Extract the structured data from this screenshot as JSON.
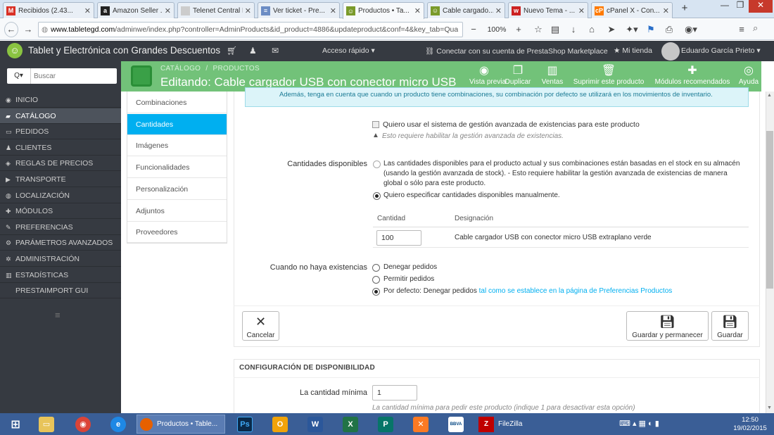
{
  "browser": {
    "tabs": [
      {
        "title": "Recibidos (2.43...",
        "icon": "gmail-icon",
        "color": "#d93025",
        "glyph": "M"
      },
      {
        "title": "Amazon Seller ...",
        "icon": "amazon-icon",
        "color": "#222222",
        "glyph": "a"
      },
      {
        "title": "Telenet Central Lo...",
        "icon": "page-icon",
        "color": "#cccccc",
        "glyph": ""
      },
      {
        "title": "Ver ticket - Pre...",
        "icon": "ticket-icon",
        "color": "#6b8cc4",
        "glyph": "≡"
      },
      {
        "title": "Productos • Ta...",
        "icon": "prestashop-icon",
        "color": "#7a9a2a",
        "glyph": "☺",
        "active": true
      },
      {
        "title": "Cable cargado...",
        "icon": "prestashop-icon",
        "color": "#7a9a2a",
        "glyph": "☺"
      },
      {
        "title": "Nuevo Tema - ...",
        "icon": "forum-icon",
        "color": "#cc2222",
        "glyph": "w"
      },
      {
        "title": "cPanel X - Con...",
        "icon": "cpanel-icon",
        "color": "#ff7a00",
        "glyph": "cP"
      }
    ],
    "new_tab": "+",
    "url_host": "www.tabletegd.com",
    "url_rest": "/adminwe/index.php?controller=AdminProducts&id_product=4886&updateproduct&conf=4&key_tab=Qua",
    "zoom": "100%"
  },
  "header": {
    "shop_name": "Tablet y Electrónica con Grandes Descuentos",
    "quick_access": "Acceso rápido",
    "connect": "Conectar con su cuenta de PrestaShop Marketplace",
    "my_shop": "Mi tienda",
    "user": "Eduardo García Prieto"
  },
  "sidebar": {
    "search_placeholder": "Buscar",
    "search_selector": "Q▾",
    "items": [
      {
        "label": "INICIO",
        "icon": "dashboard-icon",
        "glyph": "◉"
      },
      {
        "label": "CATÁLOGO",
        "icon": "catalog-icon",
        "glyph": "▰",
        "active": true
      },
      {
        "label": "PEDIDOS",
        "icon": "orders-icon",
        "glyph": "▭"
      },
      {
        "label": "CLIENTES",
        "icon": "customers-icon",
        "glyph": "♟"
      },
      {
        "label": "REGLAS DE PRECIOS",
        "icon": "price-rules-icon",
        "glyph": "◈"
      },
      {
        "label": "TRANSPORTE",
        "icon": "truck-icon",
        "glyph": "▶"
      },
      {
        "label": "LOCALIZACIÓN",
        "icon": "globe-icon",
        "glyph": "◍"
      },
      {
        "label": "MÓDULOS",
        "icon": "modules-icon",
        "glyph": "✚"
      },
      {
        "label": "PREFERENCIAS",
        "icon": "wrench-icon",
        "glyph": "✎"
      },
      {
        "label": "PARÁMETROS AVANZADOS",
        "icon": "cogs-icon",
        "glyph": "⚙"
      },
      {
        "label": "ADMINISTRACIÓN",
        "icon": "gear-icon",
        "glyph": "✲"
      },
      {
        "label": "ESTADÍSTICAS",
        "icon": "stats-icon",
        "glyph": "▥"
      },
      {
        "label": "PRESTAIMPORT GUI",
        "icon": "",
        "glyph": ""
      }
    ]
  },
  "toolbar": {
    "breadcrumb_catalog": "CATÁLOGO",
    "breadcrumb_sep": "/",
    "breadcrumb_products": "PRODUCTOS",
    "title": "Editando: Cable cargador USB con conector micro USB ext",
    "buttons": [
      {
        "label": "Vista previa",
        "icon": "eye-icon",
        "glyph": "◉"
      },
      {
        "label": "Duplicar",
        "icon": "copy-icon",
        "glyph": "❐"
      },
      {
        "label": "Ventas",
        "icon": "chart-icon",
        "glyph": "▥"
      },
      {
        "label": "Suprimir este producto",
        "icon": "trash-icon",
        "glyph": "🗑"
      },
      {
        "label": "Módulos recomendados",
        "icon": "puzzle-icon",
        "glyph": "✚"
      },
      {
        "label": "Ayuda",
        "icon": "help-icon",
        "glyph": "◎"
      }
    ]
  },
  "subtabs": [
    "Combinaciones",
    "Cantidades",
    "Imágenes",
    "Funcionalidades",
    "Personalización",
    "Adjuntos",
    "Proveedores"
  ],
  "form": {
    "info_text": "Además, tenga en cuenta que cuando un producto tiene combinaciones, su combinación por defecto se utilizará en los movimientos de inventario.",
    "advanced_stock_label": "Quiero usar el sistema de gestión avanzada de existencias para este producto",
    "advanced_stock_hint": "Esto requiere habilitar la gestión avanzada de existencias.",
    "available_label": "Cantidades disponibles",
    "available_opt1_l1": "Las cantidades disponibles para el producto actual y sus combinaciones están basadas en el stock en su almacén",
    "available_opt1_l2": "(usando la gestión avanzada de stock).  - Esto requiere habilitar la gestión avanzada de existencias de manera",
    "available_opt1_l3": "global o sólo para este producto.",
    "available_opt2": "Quiero especificar cantidades disponibles manualmente.",
    "qty_header": "Cantidad",
    "designation_header": "Designación",
    "qty_value": "100",
    "designation_value": "Cable cargador USB con conector micro USB extraplano verde",
    "oos_label": "Cuando no haya existencias",
    "oos_opt1": "Denegar pedidos",
    "oos_opt2": "Permitir pedidos",
    "oos_opt3": "Por defecto: Denegar pedidos",
    "oos_opt3_link": "tal como se establece en la página de Preferencias Productos",
    "cancel": "Cancelar",
    "save_stay": "Guardar y permanecer",
    "save": "Guardar"
  },
  "availability": {
    "title": "CONFIGURACIÓN DE DISPONIBILIDAD",
    "min_label": "La cantidad mínima",
    "min_value": "1",
    "min_hint": "La cantidad mínima para pedir este producto (indique 1 para desactivar esta opción)"
  },
  "taskbar": {
    "active_app": "Productos • Table...",
    "filezilla": "FileZilla",
    "time": "12:50",
    "date": "19/02/2015"
  }
}
